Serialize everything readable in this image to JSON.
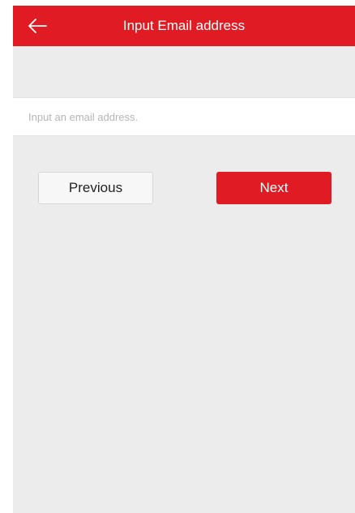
{
  "header": {
    "title": "Input Email address",
    "back_icon": "arrow-left-icon",
    "background_color": "#e01b23"
  },
  "email": {
    "value": "",
    "placeholder": "Input an email address."
  },
  "actions": {
    "previous_label": "Previous",
    "next_label": "Next",
    "next_color": "#e01b23"
  }
}
